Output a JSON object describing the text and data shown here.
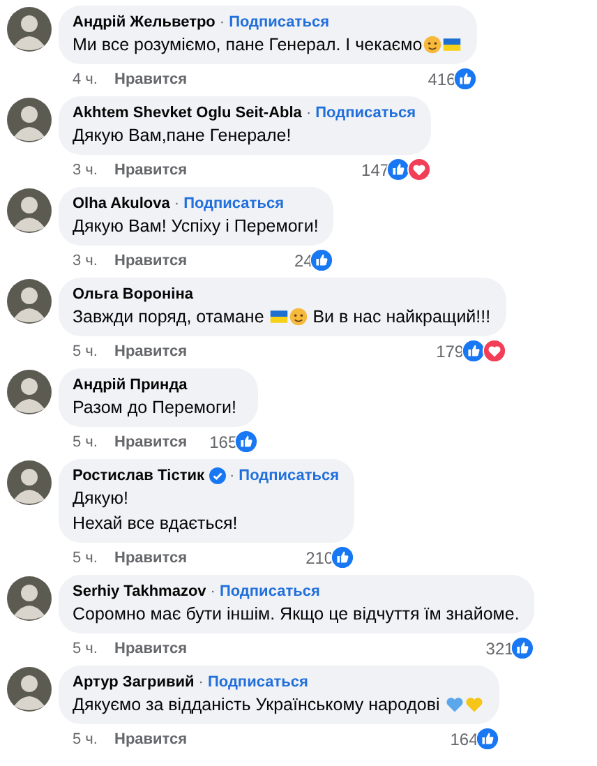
{
  "comments": [
    {
      "author": "Андрій Жельветро",
      "verified": false,
      "separator": "·",
      "follow": "Подписаться",
      "lines": [
        [
          {
            "kind": "text",
            "text": "Ми все розуміємо, пане Генерал. І чекаємо"
          },
          {
            "kind": "face"
          },
          {
            "kind": "flag"
          }
        ]
      ],
      "time": "4 ч.",
      "like": "Нравится",
      "count": "416",
      "reactions": [
        {
          "kind": "like"
        }
      ]
    },
    {
      "author": "Akhtem Shevket Oglu Seit-Abla",
      "verified": false,
      "separator": "·",
      "follow": "Подписаться",
      "lines": [
        [
          {
            "kind": "text",
            "text": "Дякую Вам,пане Генерале!"
          }
        ]
      ],
      "time": "3 ч.",
      "like": "Нравится",
      "count": "147",
      "reactions": [
        {
          "kind": "like"
        },
        {
          "kind": "love"
        }
      ]
    },
    {
      "author": "Olha Akulova",
      "verified": false,
      "separator": "·",
      "follow": "Подписаться",
      "lines": [
        [
          {
            "kind": "text",
            "text": "Дякую Вам! Успіху і Перемоги!"
          }
        ]
      ],
      "time": "3 ч.",
      "like": "Нравится",
      "count": "24",
      "reactions": [
        {
          "kind": "like"
        }
      ]
    },
    {
      "author": "Ольга Вороніна",
      "verified": false,
      "lines": [
        [
          {
            "kind": "text",
            "text": "Завжди поряд, отамане "
          },
          {
            "kind": "flag"
          },
          {
            "kind": "face"
          },
          {
            "kind": "text",
            "text": " Ви в нас найкращий!!!"
          }
        ]
      ],
      "time": "5 ч.",
      "like": "Нравится",
      "count": "179",
      "reactions": [
        {
          "kind": "like"
        },
        {
          "kind": "love"
        }
      ]
    },
    {
      "author": "Андрій Принда",
      "verified": false,
      "lines": [
        [
          {
            "kind": "text",
            "text": "Разом до Перемоги!"
          }
        ]
      ],
      "time": "5 ч.",
      "like": "Нравится",
      "count": "165",
      "reactions": [
        {
          "kind": "like"
        }
      ]
    },
    {
      "author": "Ростислав Тістик",
      "verified": true,
      "separator": "·",
      "follow": "Подписаться",
      "lines": [
        [
          {
            "kind": "text",
            "text": "Дякую!"
          }
        ],
        [
          {
            "kind": "text",
            "text": "Нехай все вдається!"
          }
        ]
      ],
      "time": "5 ч.",
      "like": "Нравится",
      "count": "210",
      "reactions": [
        {
          "kind": "like"
        }
      ]
    },
    {
      "author": "Serhiy Takhmazov",
      "verified": false,
      "separator": "·",
      "follow": "Подписаться",
      "lines": [
        [
          {
            "kind": "text",
            "text": "Соромно має бути іншім. Якщо це відчуття їм знайоме."
          }
        ]
      ],
      "time": "5 ч.",
      "like": "Нравится",
      "count": "321",
      "reactions": [
        {
          "kind": "like"
        }
      ]
    },
    {
      "author": "Артур Загривий",
      "verified": false,
      "separator": "·",
      "follow": "Подписаться",
      "lines": [
        [
          {
            "kind": "text",
            "text": "Дякуємо за відданість Українському народові "
          },
          {
            "kind": "blue-heart"
          },
          {
            "kind": "yellow-heart"
          }
        ]
      ],
      "time": "5 ч.",
      "like": "Нравится",
      "count": "164",
      "reactions": [
        {
          "kind": "like"
        }
      ]
    }
  ]
}
